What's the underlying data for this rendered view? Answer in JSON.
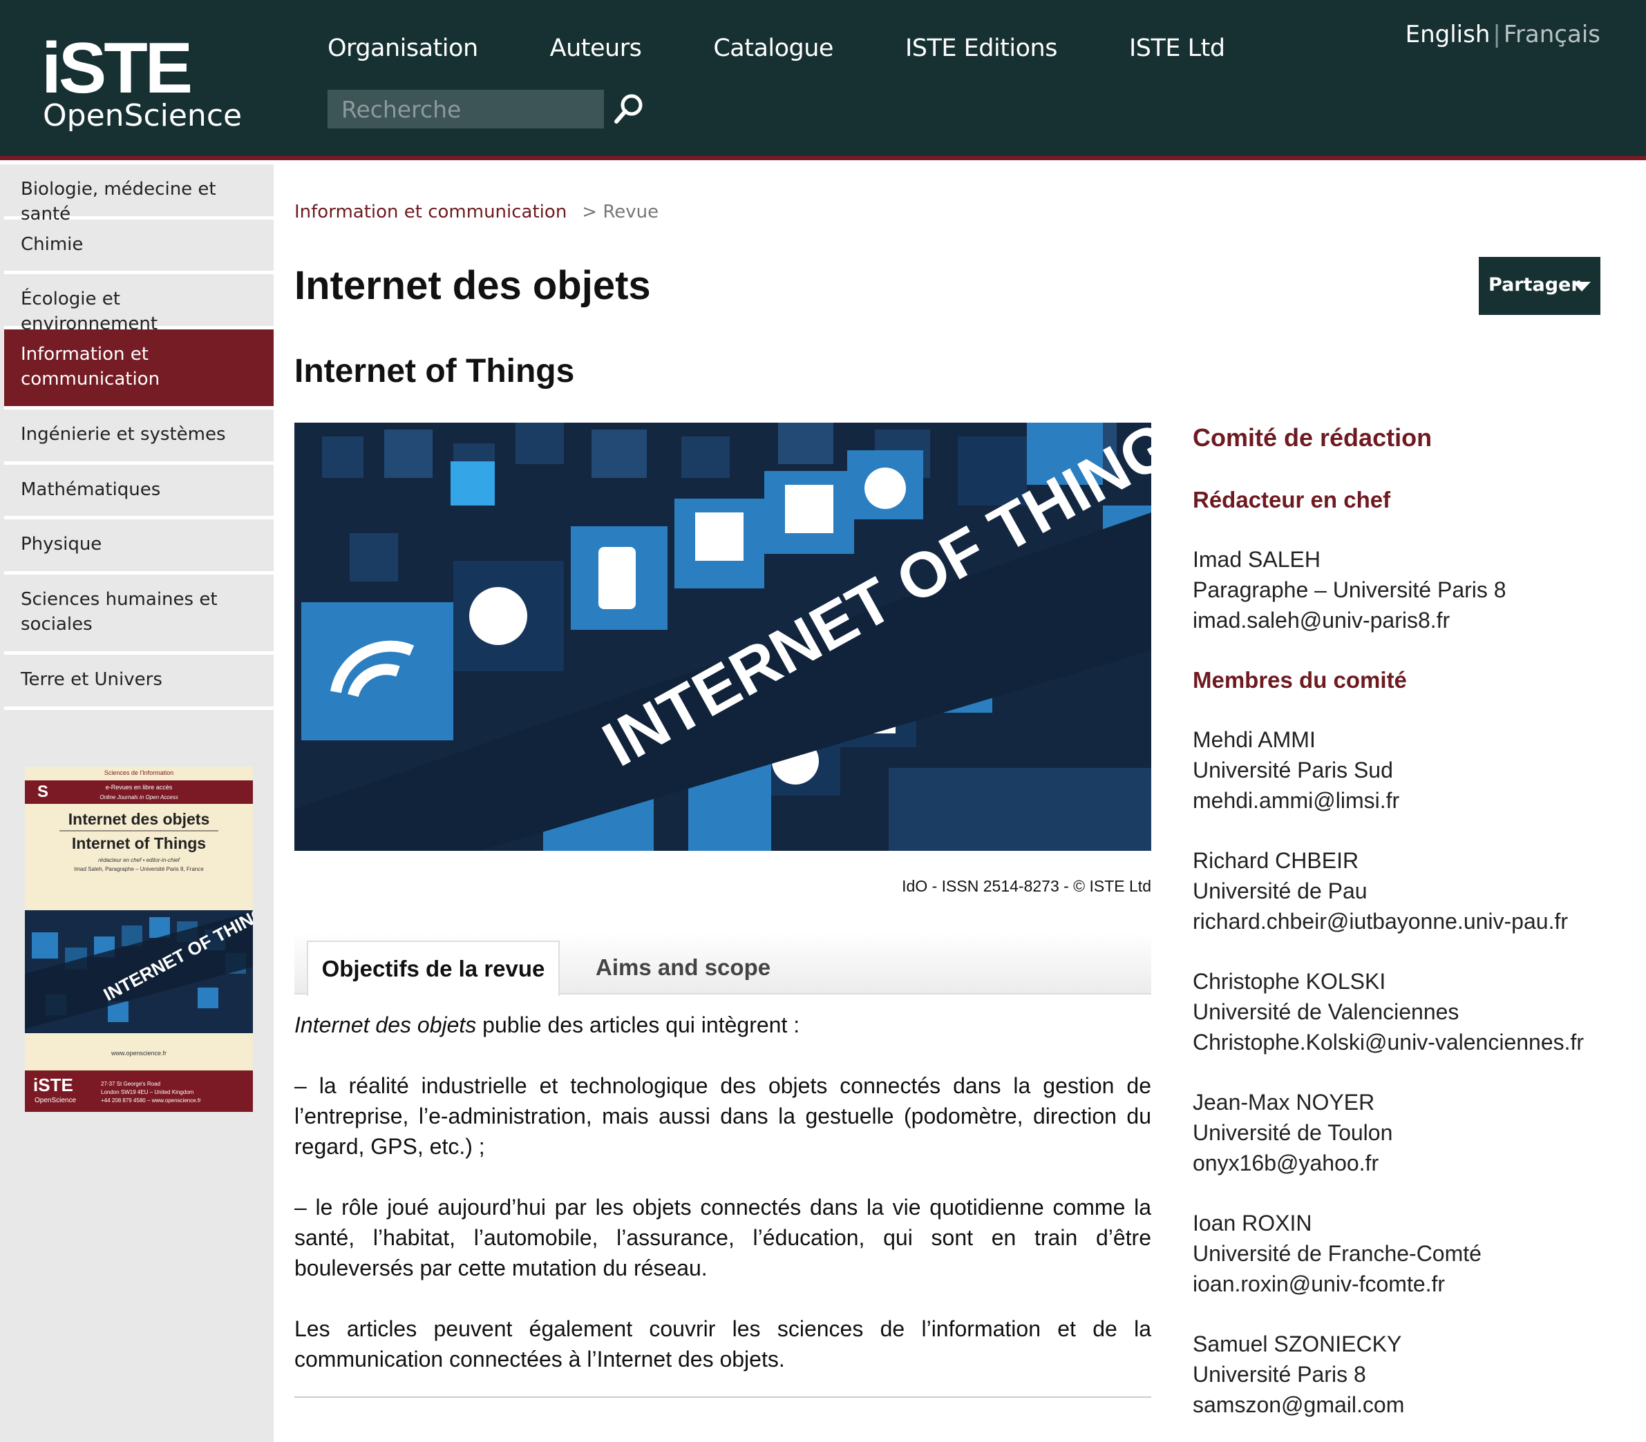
{
  "header": {
    "logo_text_top": "iSTE",
    "logo_text_bottom": "OpenScience",
    "nav": [
      "Organisation",
      "Auteurs",
      "Catalogue",
      "ISTE Editions",
      "ISTE Ltd"
    ],
    "search_placeholder": "Recherche",
    "lang_en": "English",
    "lang_sep": "|",
    "lang_fr": "Français"
  },
  "sidebar": {
    "items": [
      {
        "label": "Biologie, médecine et santé",
        "active": false
      },
      {
        "label": "Chimie",
        "active": false
      },
      {
        "label": "Écologie et environnement",
        "active": false
      },
      {
        "label": "Information et communication",
        "active": true
      },
      {
        "label": "Ingénierie et systèmes",
        "active": false
      },
      {
        "label": "Mathématiques",
        "active": false
      },
      {
        "label": "Physique",
        "active": false
      },
      {
        "label": "Sciences humaines et sociales",
        "active": false
      },
      {
        "label": "Terre et Univers",
        "active": false
      }
    ],
    "cover": {
      "kicker": "Sciences de l'Information",
      "band_1": "e-Revues en libre accès",
      "band_2": "Online Journals in Open Access",
      "title_fr": "Internet des objets",
      "title_en": "Internet of Things",
      "editor_line": "rédacteur en chef • editor-in-chief",
      "editor_name": "Imad Saleh, Paragraphe – Université Paris 8, France",
      "image_text": "INTERNET OF THINGS",
      "website": "www.openscience.fr",
      "footer_logo": "iSTE",
      "footer_logo_sub": "OpenScience",
      "addr_1": "27-37 St George's Road",
      "addr_2": "London SW19 4EU – United Kingdom",
      "addr_3": "+44 208 879 4580 – www.openscience.fr"
    }
  },
  "breadcrumb": {
    "link": "Information et communication",
    "sep": ">",
    "current": "Revue"
  },
  "page": {
    "title": "Internet des objets",
    "share_label": "Partager",
    "subtitle": "Internet of Things",
    "hero_text": "INTERNET OF THINGS",
    "caption": "IdO - ISSN 2514-8273 - © ISTE Ltd"
  },
  "tabs": {
    "active": "Objectifs de la revue",
    "other": "Aims and scope"
  },
  "content": {
    "p1_em": "Internet des objets",
    "p1_rest": " publie des articles qui intègrent :",
    "p2": "– la réalité industrielle et technologique des objets connectés dans la gestion de l’entreprise, l’e-administration, mais aussi dans la gestuelle (podomètre, direction du regard, GPS, etc.) ;",
    "p3": "– le rôle joué aujourd’hui par les objets connectés dans la vie quotidienne comme la santé, l’habitat, l’automobile, l’assurance, l’éducation, qui sont en train d’être bouleversés par cette mutation du réseau.",
    "p4": "Les articles peuvent également couvrir les sciences de l’information et de la communication connectées à l’Internet des objets."
  },
  "committee": {
    "heading": "Comité de rédaction",
    "chief_heading": "Rédacteur en chef",
    "chief": {
      "name": "Imad SALEH",
      "affiliation": "Paragraphe – Université Paris 8",
      "email": "imad.saleh@univ-paris8.fr"
    },
    "members_heading": "Membres du comité",
    "members": [
      {
        "name": "Mehdi AMMI",
        "affiliation": "Université Paris Sud",
        "email": "mehdi.ammi@limsi.fr"
      },
      {
        "name": "Richard CHBEIR",
        "affiliation": "Université de Pau",
        "email": "richard.chbeir@iutbayonne.univ-pau.fr"
      },
      {
        "name": "Christophe KOLSKI",
        "affiliation": "Université de Valenciennes",
        "email": "Christophe.Kolski@univ-valenciennes.fr"
      },
      {
        "name": "Jean-Max NOYER",
        "affiliation": "Université de Toulon",
        "email": "onyx16b@yahoo.fr"
      },
      {
        "name": "Ioan ROXIN",
        "affiliation": "Université de Franche-Comté",
        "email": "ioan.roxin@univ-fcomte.fr"
      },
      {
        "name": "Samuel SZONIECKY",
        "affiliation": "Université Paris 8",
        "email": "samszon@gmail.com"
      }
    ]
  },
  "colors": {
    "header_bg": "#173133",
    "accent": "#751c25",
    "link": "#6e1a20",
    "hero_blue": "#2b7fc0"
  }
}
